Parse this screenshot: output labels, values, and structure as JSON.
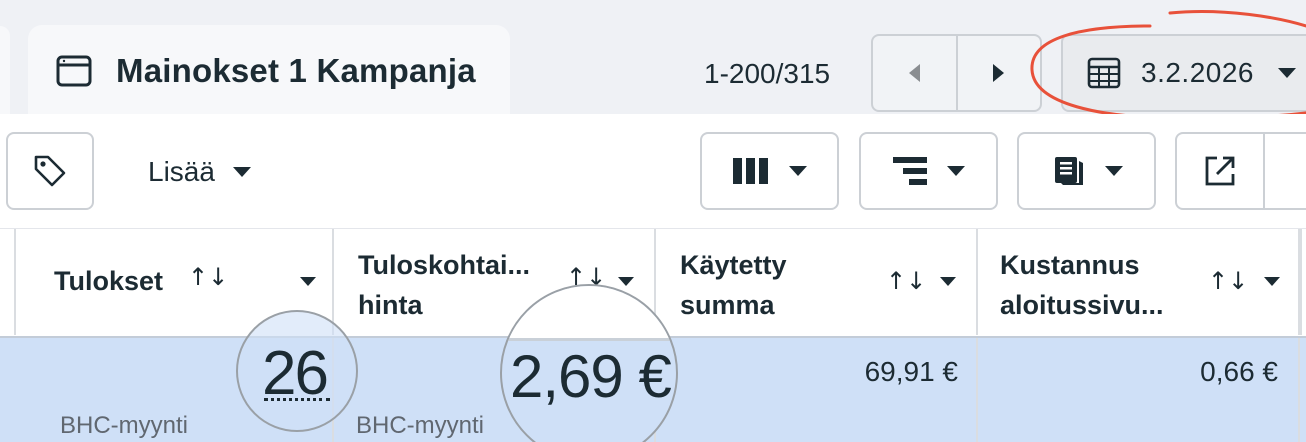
{
  "tab": {
    "title": "Mainokset 1 Kampanja",
    "icon": "ad-window-icon"
  },
  "pager": {
    "count": "1-200/315"
  },
  "date_picker": {
    "value": "3.2.2026",
    "icon": "calendar-icon"
  },
  "toolbar": {
    "tag_icon": "tag-icon",
    "add_label": "Lisää",
    "columns_icon": "columns-icon",
    "breakdown_icon": "breakdown-icon",
    "reports_icon": "reports-icon",
    "export_icon": "export-icon"
  },
  "table": {
    "headers": [
      {
        "label": "Tulokset",
        "sort": "↑↓"
      },
      {
        "label_line1": "Tuloskohtai...",
        "label_line2": "hinta",
        "sort": "↑↓"
      },
      {
        "label_line1": "Käytetty",
        "label_line2": "summa",
        "sort": "↑↓"
      },
      {
        "label_line1": "Kustannus",
        "label_line2": "aloitussivu...",
        "sort": "↑↓"
      }
    ],
    "row": {
      "results": "26",
      "results_sub": "BHC-myynti",
      "cost_per_result": "2,69 €",
      "cost_per_result_sub": "BHC-myynti",
      "amount_spent": "69,91 €",
      "cost_landing": "0,66 €"
    }
  },
  "colors": {
    "accent_red": "#e8513a",
    "selected_row": "#cfe0f7"
  }
}
